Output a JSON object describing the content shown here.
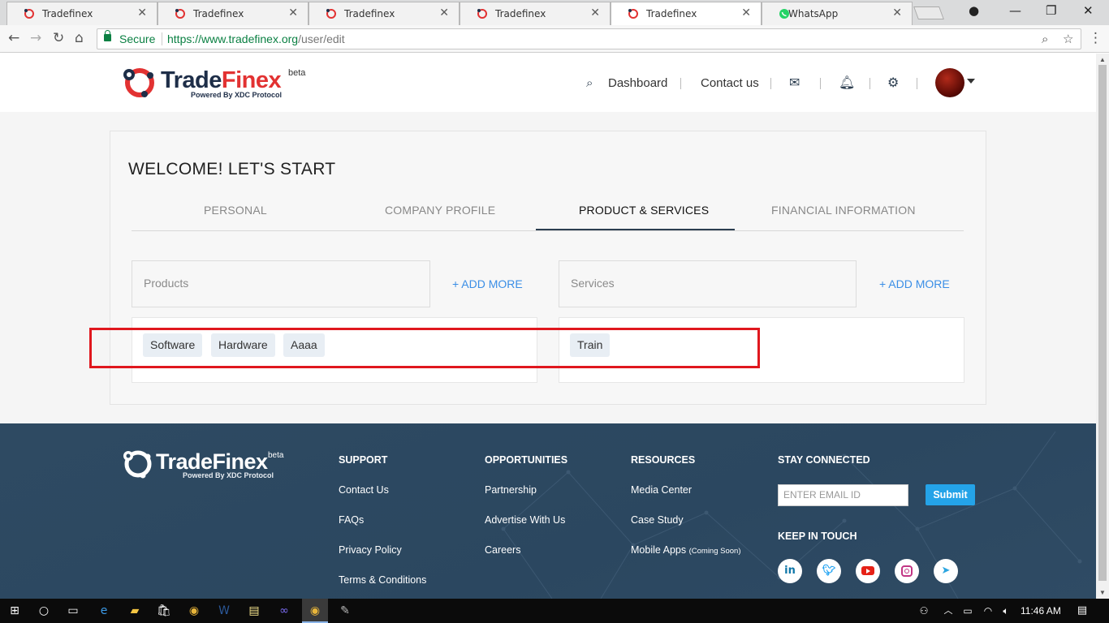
{
  "browser": {
    "tabs": [
      {
        "title": "Tradefinex",
        "icon": "tradefinex-favicon"
      },
      {
        "title": "Tradefinex",
        "icon": "tradefinex-favicon"
      },
      {
        "title": "Tradefinex",
        "icon": "tradefinex-favicon"
      },
      {
        "title": "Tradefinex",
        "icon": "tradefinex-favicon"
      },
      {
        "title": "Tradefinex",
        "icon": "tradefinex-favicon",
        "active": true
      },
      {
        "title": "WhatsApp",
        "icon": "whatsapp-favicon"
      }
    ],
    "secure_label": "Secure",
    "url_host": "https://www.tradefinex.org",
    "url_path": "/user/edit"
  },
  "header": {
    "logo_trade": "Trade",
    "logo_finex": "Finex",
    "logo_beta": "beta",
    "logo_sub": "Powered By XDC Protocol",
    "nav": {
      "dashboard": "Dashboard",
      "contact": "Contact us"
    }
  },
  "page": {
    "title": "WELCOME! LET'S START",
    "tabs": [
      "PERSONAL",
      "COMPANY PROFILE",
      "PRODUCT & SERVICES",
      "FINANCIAL INFORMATION"
    ],
    "active_tab": "PRODUCT & SERVICES",
    "products": {
      "placeholder": "Products",
      "add_more": "+ ADD MORE",
      "tags": [
        "Software",
        "Hardware",
        "Aaaa"
      ]
    },
    "services": {
      "placeholder": "Services",
      "add_more": "+ ADD MORE",
      "tags": [
        "Train"
      ]
    },
    "highlight_color": "#e0171e"
  },
  "footer": {
    "logo_text": "TradeFinex",
    "logo_beta": "beta",
    "logo_sub": "Powered By XDC Protocol",
    "support": {
      "heading": "SUPPORT",
      "links": [
        "Contact Us",
        "FAQs",
        "Privacy Policy",
        "Terms & Conditions"
      ]
    },
    "opportunities": {
      "heading": "OPPORTUNITIES",
      "links": [
        "Partnership",
        "Advertise With Us",
        "Careers"
      ]
    },
    "resources": {
      "heading": "RESOURCES",
      "links": [
        "Media Center",
        "Case Study",
        "Mobile Apps"
      ],
      "coming_soon": "(Coming Soon)"
    },
    "stay_connected": {
      "heading": "STAY CONNECTED",
      "email_placeholder": "ENTER EMAIL ID",
      "submit": "Submit"
    },
    "keep_in_touch": {
      "heading": "KEEP IN TOUCH",
      "socials": [
        "linkedin-icon",
        "twitter-icon",
        "youtube-icon",
        "instagram-icon",
        "telegram-icon"
      ]
    }
  },
  "taskbar": {
    "time": "11:46 AM"
  },
  "colors": {
    "brand_navy": "#1e2e48",
    "brand_red": "#e23232",
    "link_blue": "#3a8ee6",
    "footer_bg": "#2e4a62",
    "submit_blue": "#24a3e8"
  }
}
